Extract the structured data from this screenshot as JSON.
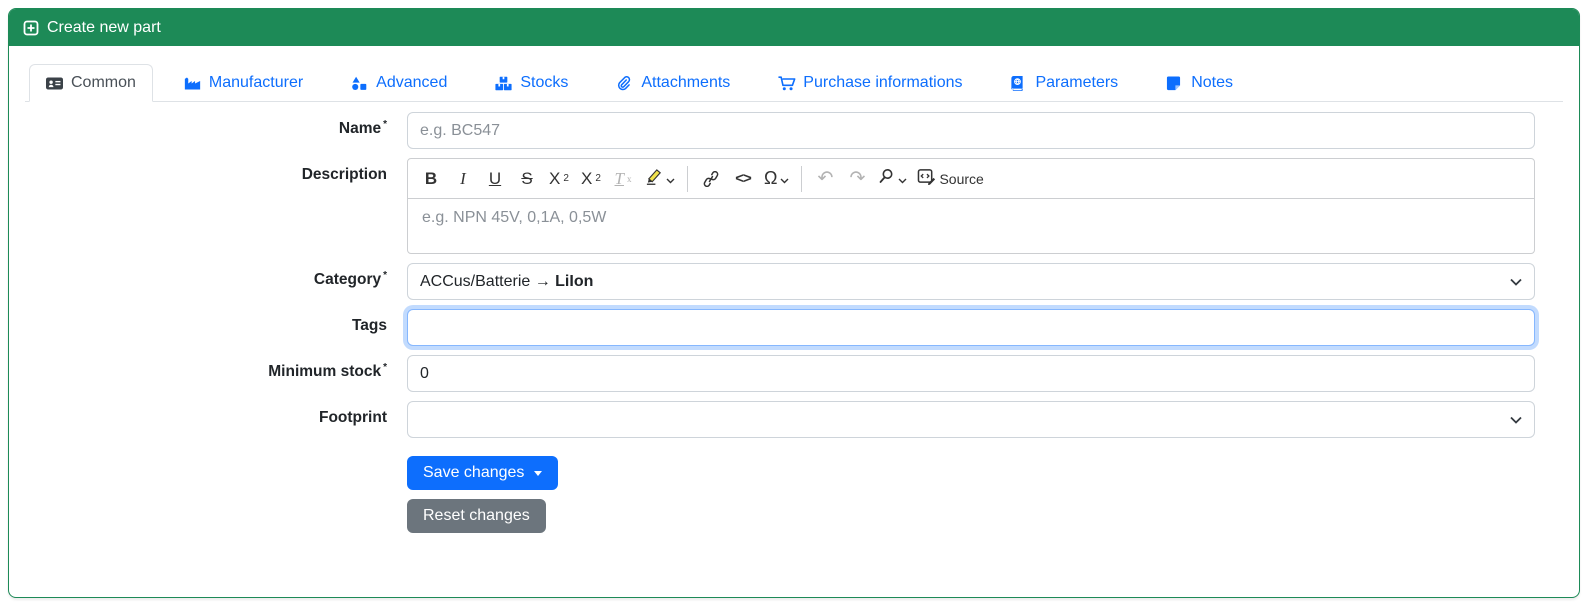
{
  "colors": {
    "header_green": "#1d8a57",
    "tab_link_blue": "#0d6efd",
    "active_tab_text": "#495057",
    "save_button": "#0d6efd",
    "reset_button": "#6c757d",
    "focus_ring": "#86b7fe"
  },
  "header": {
    "title": "Create new part",
    "icon": "square-plus-icon"
  },
  "tabs": [
    {
      "label": "Common",
      "icon": "address-card-icon",
      "active": true
    },
    {
      "label": "Manufacturer",
      "icon": "factory-icon",
      "active": false
    },
    {
      "label": "Advanced",
      "icon": "shapes-icon",
      "active": false
    },
    {
      "label": "Stocks",
      "icon": "boxes-icon",
      "active": false
    },
    {
      "label": "Attachments",
      "icon": "paperclip-icon",
      "active": false
    },
    {
      "label": "Purchase informations",
      "icon": "cart-icon",
      "active": false
    },
    {
      "label": "Parameters",
      "icon": "book-atlas-icon",
      "active": false
    },
    {
      "label": "Notes",
      "icon": "sticky-note-icon",
      "active": false
    }
  ],
  "form": {
    "required_marker": "*",
    "name": {
      "label": "Name",
      "required": true,
      "value": "",
      "placeholder": "e.g. BC547"
    },
    "description": {
      "label": "Description",
      "placeholder": "e.g. NPN 45V, 0,1A, 0,5W",
      "toolbar": {
        "bold": "B",
        "italic": "I",
        "underline": "U",
        "strikethrough": "S",
        "subscript_base": "X",
        "subscript_small": "2",
        "superscript_base": "X",
        "superscript_small": "2",
        "remove_format_base": "T",
        "remove_format_small": "x",
        "code": "<>",
        "special_char": "Ω",
        "undo": "↶",
        "redo": "↷",
        "source_label": "Source"
      }
    },
    "category": {
      "label": "Category",
      "required": true,
      "value_prefix": "ACCus/Batterie → ",
      "value_leaf": "LiIon"
    },
    "tags": {
      "label": "Tags",
      "value": "",
      "focused": true
    },
    "minimum_stock": {
      "label": "Minimum stock",
      "required": true,
      "value": "0"
    },
    "footprint": {
      "label": "Footprint",
      "value": ""
    }
  },
  "buttons": {
    "save": "Save changes",
    "reset": "Reset changes"
  }
}
